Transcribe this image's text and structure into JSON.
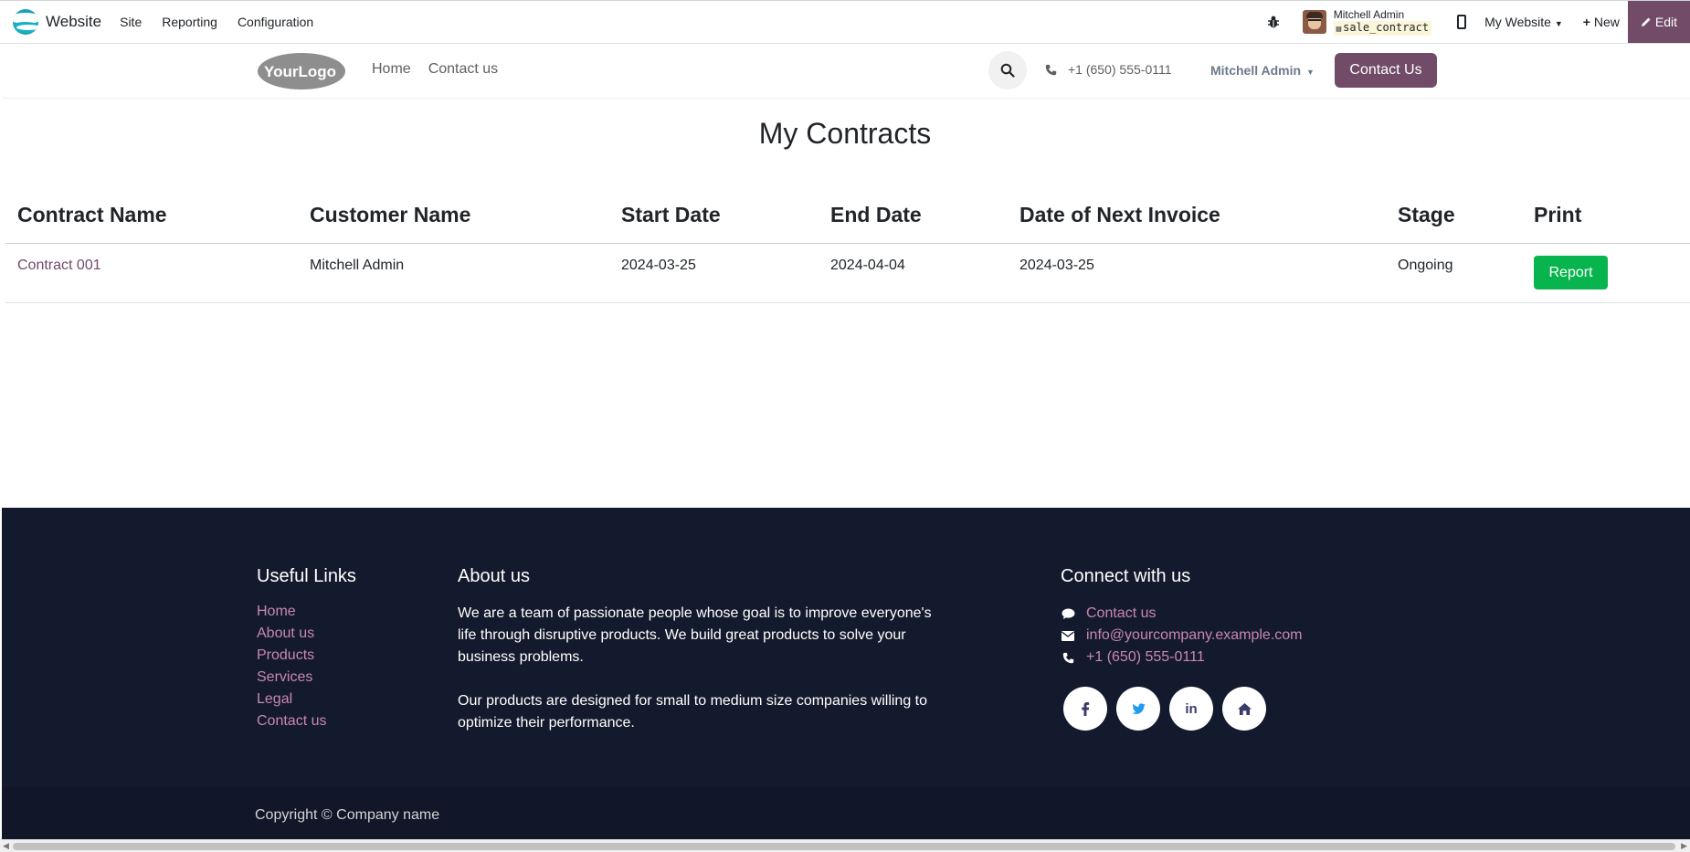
{
  "topbar": {
    "app_name": "Website",
    "menus": [
      "Site",
      "Reporting",
      "Configuration"
    ],
    "user_name": "Mitchell Admin",
    "db_name": "sale_contract",
    "website_selector": "My Website",
    "new_label": "New",
    "edit_label": "Edit"
  },
  "header": {
    "logo_text": "YourLogo",
    "nav": [
      "Home",
      "Contact us"
    ],
    "phone": "+1 (650) 555-0111",
    "account": "Mitchell Admin",
    "cta_label": "Contact Us"
  },
  "page": {
    "title": "My Contracts",
    "columns": [
      "Contract Name",
      "Customer Name",
      "Start Date",
      "End Date",
      "Date of Next Invoice",
      "Stage",
      "Print"
    ],
    "rows": [
      {
        "contract_name": "Contract 001",
        "customer_name": "Mitchell Admin",
        "start_date": "2024-03-25",
        "end_date": "2024-04-04",
        "next_invoice": "2024-03-25",
        "stage": "Ongoing",
        "print_label": "Report"
      }
    ]
  },
  "footer": {
    "useful_links_title": "Useful Links",
    "useful_links": [
      "Home",
      "About us",
      "Products",
      "Services",
      "Legal",
      "Contact us"
    ],
    "about_title": "About us",
    "about_p1": "We are a team of passionate people whose goal is to improve everyone's life through disruptive products. We build great products to solve your business problems.",
    "about_p2": "Our products are designed for small to medium size companies willing to optimize their performance.",
    "connect_title": "Connect with us",
    "connect_contact": "Contact us",
    "connect_email": "info@yourcompany.example.com",
    "connect_phone": "+1 (650) 555-0111",
    "social_icons": [
      "facebook-icon",
      "twitter-icon",
      "linkedin-icon",
      "home-icon"
    ],
    "copyright": "Copyright © Company name"
  },
  "colors": {
    "brand": "#714b67",
    "report_button": "#08b44d",
    "footer_bg": "#141a2d",
    "footer_link": "#c886b5"
  }
}
